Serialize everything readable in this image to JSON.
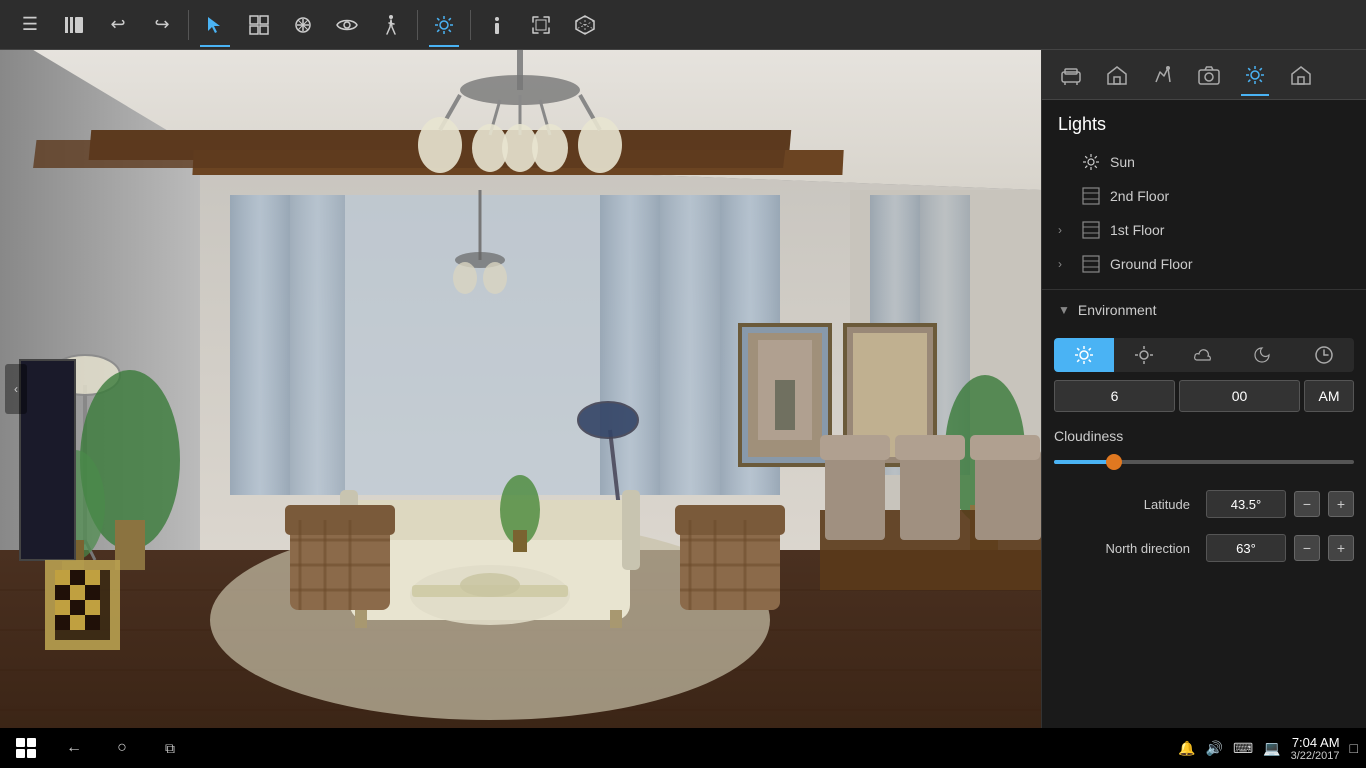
{
  "toolbar": {
    "buttons": [
      {
        "id": "menu",
        "icon": "☰",
        "label": "Menu",
        "active": false
      },
      {
        "id": "library",
        "icon": "📚",
        "label": "Library",
        "active": false
      },
      {
        "id": "undo",
        "icon": "↩",
        "label": "Undo",
        "active": false
      },
      {
        "id": "redo",
        "icon": "↪",
        "label": "Redo",
        "active": false
      },
      {
        "id": "select",
        "icon": "↖",
        "label": "Select",
        "active": true
      },
      {
        "id": "arrange",
        "icon": "⊞",
        "label": "Arrange",
        "active": false
      },
      {
        "id": "transform",
        "icon": "✂",
        "label": "Transform",
        "active": false
      },
      {
        "id": "view",
        "icon": "👁",
        "label": "View",
        "active": false
      },
      {
        "id": "walk",
        "icon": "🚶",
        "label": "Walk",
        "active": false
      },
      {
        "id": "lights_tb",
        "icon": "☀",
        "label": "Lights",
        "active": true
      },
      {
        "id": "info",
        "icon": "ℹ",
        "label": "Info",
        "active": false
      },
      {
        "id": "fullscreen",
        "icon": "⛶",
        "label": "Fullscreen",
        "active": false
      },
      {
        "id": "3d",
        "icon": "◈",
        "label": "3D",
        "active": false
      }
    ]
  },
  "right_panel": {
    "icons": [
      {
        "id": "furniture",
        "icon": "🪑",
        "label": "Furniture",
        "active": false
      },
      {
        "id": "structure",
        "icon": "🏠",
        "label": "Structure",
        "active": false
      },
      {
        "id": "decor",
        "icon": "🖊",
        "label": "Decor",
        "active": false
      },
      {
        "id": "camera",
        "icon": "📷",
        "label": "Camera",
        "active": false
      },
      {
        "id": "sun",
        "icon": "☀",
        "label": "Sun",
        "active": true
      },
      {
        "id": "home",
        "icon": "🏡",
        "label": "Home",
        "active": false
      }
    ],
    "lights_section": {
      "title": "Lights",
      "items": [
        {
          "id": "sun",
          "type": "sun",
          "label": "Sun",
          "has_arrow": false
        },
        {
          "id": "2nd_floor",
          "type": "floor",
          "label": "2nd Floor",
          "has_arrow": false
        },
        {
          "id": "1st_floor",
          "type": "floor",
          "label": "1st Floor",
          "has_arrow": true
        },
        {
          "id": "ground_floor",
          "type": "floor",
          "label": "Ground Floor",
          "has_arrow": true
        }
      ]
    },
    "environment": {
      "title": "Environment",
      "toggle_buttons": [
        {
          "id": "clear",
          "icon": "☀✦",
          "label": "Clear Day",
          "active": true
        },
        {
          "id": "sunny",
          "icon": "☀",
          "label": "Sunny",
          "active": false
        },
        {
          "id": "cloudy",
          "icon": "☁",
          "label": "Cloudy",
          "active": false
        },
        {
          "id": "night",
          "icon": "☽",
          "label": "Night",
          "active": false
        },
        {
          "id": "clock",
          "icon": "🕐",
          "label": "Custom",
          "active": false
        }
      ],
      "time_hour": "6",
      "time_minute": "00",
      "time_ampm": "AM",
      "cloudiness_label": "Cloudiness",
      "cloudiness_value": 20,
      "latitude_label": "Latitude",
      "latitude_value": "43.5°",
      "north_direction_label": "North direction",
      "north_direction_value": "63°"
    }
  },
  "taskbar": {
    "time": "7:04 AM",
    "date": "3/22/2017",
    "system_icons": [
      "🔊",
      "💻",
      "⌨"
    ]
  },
  "left_nav": {
    "toggle_label": "‹"
  }
}
